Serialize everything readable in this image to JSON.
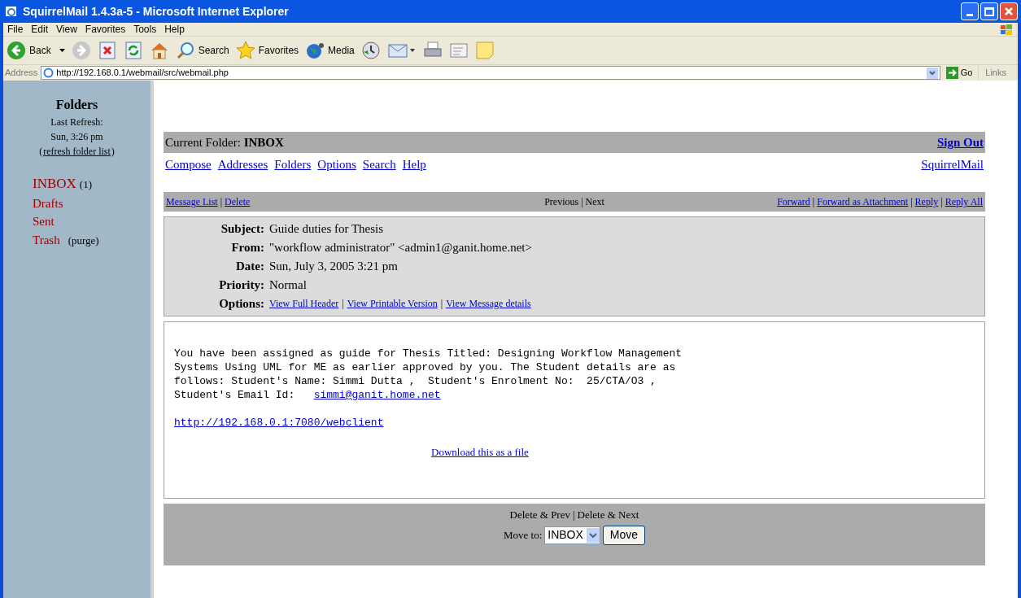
{
  "window": {
    "title": "SquirrelMail 1.4.3a-5 - Microsoft Internet Explorer"
  },
  "menu": [
    "File",
    "Edit",
    "View",
    "Favorites",
    "Tools",
    "Help"
  ],
  "toolbar": [
    {
      "kind": "back",
      "label": "Back"
    },
    {
      "kind": "forward"
    },
    {
      "kind": "stop"
    },
    {
      "kind": "refresh"
    },
    {
      "kind": "home"
    },
    {
      "kind": "search",
      "label": "Search"
    },
    {
      "kind": "favorites",
      "label": "Favorites"
    },
    {
      "kind": "media",
      "label": "Media"
    },
    {
      "kind": "history"
    },
    {
      "kind": "mail"
    },
    {
      "kind": "print"
    },
    {
      "kind": "edit"
    },
    {
      "kind": "note"
    }
  ],
  "address_bar": {
    "label": "Address",
    "value": "http://192.168.0.1/webmail/src/webmail.php",
    "go": "Go",
    "links": "Links"
  },
  "sidebar": {
    "title": "Folders",
    "refresh_label": "Last Refresh:",
    "refresh_time": "Sun, 3:26 pm",
    "refresh_link": "refresh folder list",
    "refresh_brackets": [
      "(",
      ")"
    ],
    "folders": [
      {
        "name": "INBOX",
        "selected": true,
        "count": "(1)"
      },
      {
        "name": "Drafts",
        "selected": false
      },
      {
        "name": "Sent",
        "selected": false
      },
      {
        "name": "Trash",
        "selected": false,
        "action": "(purge)"
      }
    ]
  },
  "separator": "|",
  "current_folder": "Current Folder: **INBOX**",
  "sign_out": "Sign Out",
  "nav_links": [
    "Compose",
    "Addresses",
    "Folders",
    "Options",
    "Search",
    "Help"
  ],
  "brand_link": "SquirrelMail",
  "message_bar": {
    "left": [
      "Message List",
      "Delete"
    ],
    "center": [
      "Previous",
      "Next"
    ],
    "right": [
      "Forward",
      "Forward as Attachment",
      "Reply",
      "Reply All"
    ]
  },
  "headers": [
    {
      "label": "Subject:",
      "value": "Guide duties for Thesis"
    },
    {
      "label": "From:",
      "value": "\"workflow administrator\" <admin1@ganit.home.net>"
    },
    {
      "label": "Date:",
      "value": "Sun, July 3, 2005 3:21 pm"
    },
    {
      "label": "Priority:",
      "value": "Normal"
    }
  ],
  "options": {
    "label": "Options:",
    "links": [
      "View Full Header",
      "View Printable Version",
      "View Message details"
    ]
  },
  "body": {
    "lines": [
      "You have been assigned as guide for Thesis Titled: Designing Workflow Management",
      "Systems Using UML for ME as earlier approved by you. The Student details are as",
      "follows: Student's Name: Simmi Dutta ,  Student's Enrolment No:  25/CTA/O3 ,"
    ],
    "email_prefix": "Student's Email Id:   ",
    "email_link": "simmi@ganit.home.net",
    "url_link": "http://192.168.0.1:7080/webclient",
    "download_link": "Download this as a file"
  },
  "footer": {
    "actions": [
      "Delete & Prev",
      "Delete & Next"
    ],
    "move_label": "Move to:",
    "move_value": "INBOX",
    "move_button": "Move"
  }
}
